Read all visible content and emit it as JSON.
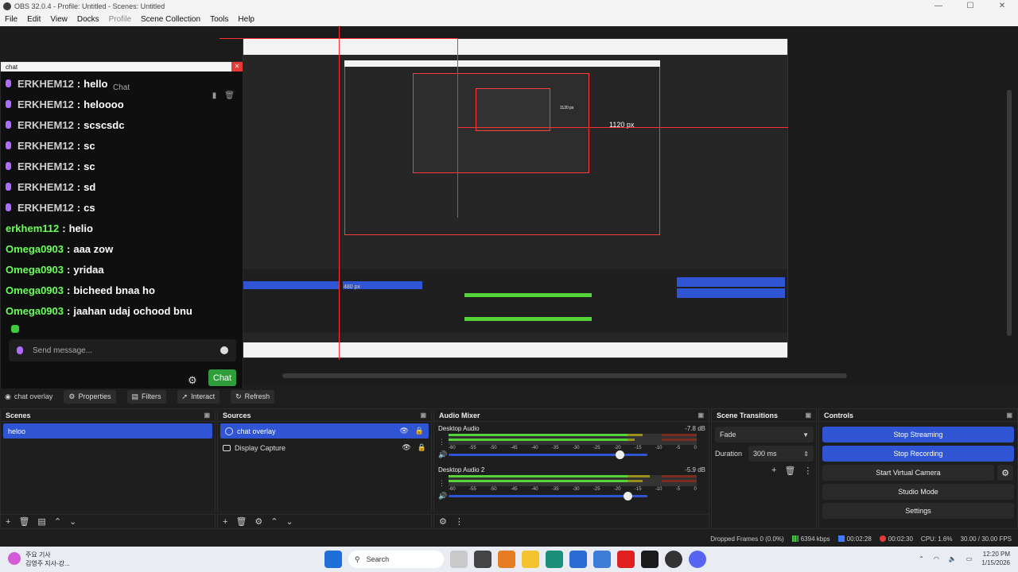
{
  "window": {
    "title": "OBS 32.0.4 - Profile: Untitled - Scenes: Untitled"
  },
  "menu": [
    "File",
    "Edit",
    "View",
    "Docks",
    "Profile",
    "Scene Collection",
    "Tools",
    "Help"
  ],
  "preview": {
    "width_label": "1120 px",
    "small_label": "1120 px",
    "source_label": "480 px"
  },
  "chat": {
    "window_title": "chat",
    "dock_label": "Chat",
    "messages": [
      {
        "user": "ERKHEM12",
        "text": "hello",
        "style": "purple"
      },
      {
        "user": "ERKHEM12",
        "text": "heloooo",
        "style": "purple"
      },
      {
        "user": "ERKHEM12",
        "text": "scscsdc",
        "style": "purple"
      },
      {
        "user": "ERKHEM12",
        "text": "sc",
        "style": "purple"
      },
      {
        "user": "ERKHEM12",
        "text": "sc",
        "style": "purple"
      },
      {
        "user": "ERKHEM12",
        "text": "sd",
        "style": "purple"
      },
      {
        "user": "ERKHEM12",
        "text": "cs",
        "style": "purple"
      },
      {
        "user": "erkhem112",
        "text": "helio",
        "style": "green"
      },
      {
        "user": "Omega0903",
        "text": "aaa zow",
        "style": "green"
      },
      {
        "user": "Omega0903",
        "text": "yridaa",
        "style": "green"
      },
      {
        "user": "Omega0903",
        "text": "bicheed bnaa ho",
        "style": "green"
      },
      {
        "user": "Omega0903",
        "text": "jaahan udaj ochood bnu",
        "style": "green"
      }
    ],
    "input_placeholder": "Send message...",
    "send_label": "Chat"
  },
  "context_bar": {
    "source": "chat overlay",
    "properties": "Properties",
    "filters": "Filters",
    "interact": "Interact",
    "refresh": "Refresh"
  },
  "scenes": {
    "title": "Scenes",
    "items": [
      "heloo"
    ]
  },
  "sources": {
    "title": "Sources",
    "items": [
      "chat overlay",
      "Display Capture"
    ]
  },
  "audio": {
    "title": "Audio Mixer",
    "ticks": [
      "-60",
      "-55",
      "-50",
      "-45",
      "-40",
      "-35",
      "-30",
      "-25",
      "-20",
      "-15",
      "-10",
      "-5",
      "0"
    ],
    "channels": [
      {
        "name": "Desktop Audio",
        "db": "-7.8 dB",
        "level": 0.78,
        "volume": 0.86
      },
      {
        "name": "Desktop Audio 2",
        "db": "-5.9 dB",
        "level": 0.81,
        "volume": 0.9
      }
    ]
  },
  "transitions": {
    "title": "Scene Transitions",
    "selected": "Fade",
    "duration_label": "Duration",
    "duration_value": "300 ms"
  },
  "controls": {
    "title": "Controls",
    "buttons": [
      "Stop Streaming",
      "Stop Recording",
      "Start Virtual Camera",
      "Studio Mode",
      "Settings"
    ]
  },
  "status": {
    "dropped": "Dropped Frames 0 (0.0%)",
    "kbps": "6394 kbps",
    "stream_time": "00:02:28",
    "rec_time": "00:02:30",
    "cpu": "CPU: 1.6%",
    "fps": "30.00 / 30.00 FPS"
  },
  "taskbar": {
    "news_line1": "주요 기사",
    "news_line2": "김영주 지사-강...",
    "search": "Search",
    "time": "12:20 PM",
    "date": "1/15/2026"
  },
  "colors": {
    "accent": "#2f55d4",
    "green": "#57d33a",
    "record_red": "#e53935"
  }
}
